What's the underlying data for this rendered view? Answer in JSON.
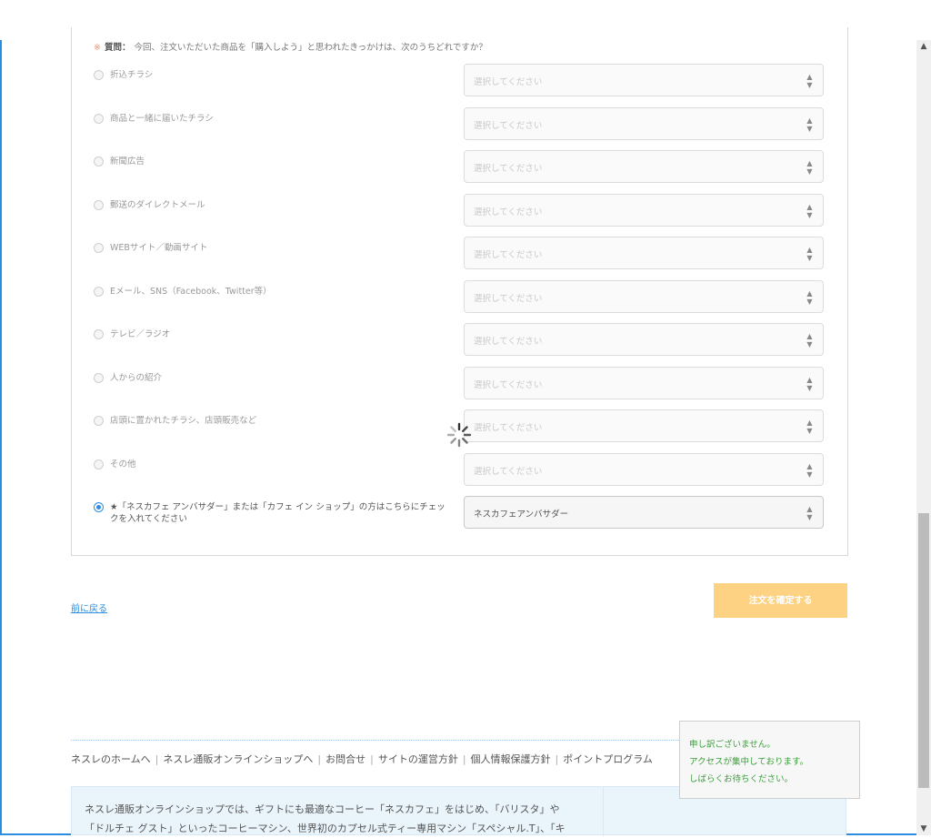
{
  "survey": {
    "question": {
      "required_mark": "※",
      "label": "質問：",
      "text": "今回、注文いただいた商品を「購入しよう」と思われたきっかけは、次のうちどれですか？"
    },
    "select_placeholder": "選択してください",
    "options": [
      {
        "label": "折込チラシ",
        "selected": false
      },
      {
        "label": "商品と一緒に届いたチラシ",
        "selected": false
      },
      {
        "label": "新聞広告",
        "selected": false
      },
      {
        "label": "郵送のダイレクトメール",
        "selected": false
      },
      {
        "label": "WEBサイト／動画サイト",
        "selected": false
      },
      {
        "label": "Eメール、SNS（Facebook、Twitter等）",
        "selected": false
      },
      {
        "label": "テレビ／ラジオ",
        "selected": false
      },
      {
        "label": "人からの紹介",
        "selected": false
      },
      {
        "label": "店頭に置かれたチラシ、店頭販売など",
        "selected": false
      },
      {
        "label": "その他",
        "selected": false
      },
      {
        "label": "★「ネスカフェ アンバサダー」または「カフェ イン ショップ」の方はこちらにチェックを入れてください",
        "selected": true,
        "select_value": "ネスカフェアンバサダー"
      }
    ]
  },
  "nav": {
    "back_label": "前に戻る",
    "confirm_label": "注文を確定する"
  },
  "footer": {
    "links": [
      "ネスレのホームへ",
      "ネスレ通販オンラインショップへ",
      "お問合せ",
      "サイトの運営方針",
      "個人情報保護方針",
      "ポイントプログラム"
    ],
    "info_lines": [
      "ネスレ通販オンラインショップでは、ギフトにも最適なコーヒー「ネスカフェ」をはじめ、「バリスタ」や",
      "「ドルチェ グスト」といったコーヒーマシン、世界初のカプセル式ティー専用マシン「スペシャル.T」、「キ"
    ]
  },
  "notice": {
    "line1": "申し訳ございません。",
    "line2": "アクセスが集中しております。",
    "line3": "しばらくお待ちください。"
  },
  "colors": {
    "accent": "#2b8de0",
    "confirm_button": "#fdd283",
    "notice_text": "#3a9e3a"
  }
}
